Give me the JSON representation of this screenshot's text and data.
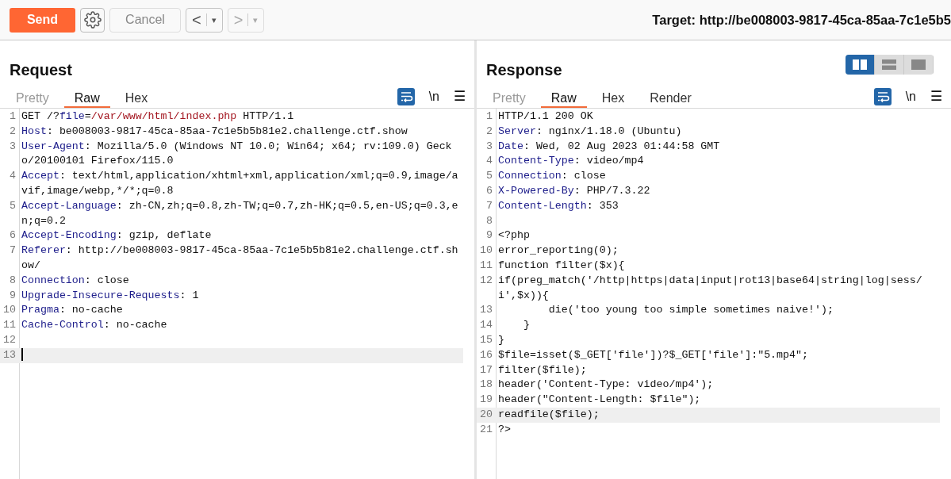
{
  "toolbar": {
    "send": "Send",
    "cancel": {
      "label": "Cancel",
      "disabled": true
    },
    "back": {
      "label": "<",
      "dropdown": "▾",
      "disabled": false
    },
    "forward": {
      "label": ">",
      "dropdown": "▾",
      "disabled": true
    },
    "target": "Target: http://be008003-9817-45ca-85aa-7c1e5b5"
  },
  "layout_toggle": [
    {
      "kind": "columns",
      "selected": true
    },
    {
      "kind": "rows",
      "selected": false
    },
    {
      "kind": "single",
      "selected": false
    }
  ],
  "panels": [
    {
      "title": "Request",
      "tabs": [
        {
          "label": "Pretty",
          "selected": false
        },
        {
          "label": "Raw",
          "selected": true
        },
        {
          "label": "Hex",
          "selected": false
        }
      ],
      "tools": {
        "wrap": true,
        "newline": "\\n",
        "menu": "☰"
      },
      "lines": [
        {
          "number": "1",
          "highlighted": false,
          "parts": [
            {
              "kind": "text",
              "text": "GET /?"
            },
            {
              "kind": "name",
              "text": "file"
            },
            {
              "kind": "text",
              "text": "="
            },
            {
              "kind": "param",
              "text": "/var/www/html/index.php"
            },
            {
              "kind": "text",
              "text": " HTTP/1.1"
            }
          ]
        },
        {
          "number": "2",
          "highlighted": false,
          "parts": [
            {
              "kind": "name",
              "text": "Host"
            },
            {
              "kind": "text",
              "text": ": be008003-9817-45ca-85aa-7c1e5b5b81e2.challenge.ctf.show"
            }
          ]
        },
        {
          "number": "3",
          "highlighted": false,
          "parts": [
            {
              "kind": "name",
              "text": "User-Agent"
            },
            {
              "kind": "text",
              "text": ": Mozilla/5.0 (Windows NT 10.0; Win64; x64; rv:109.0) Gecko/20100101 Firefox/115.0"
            }
          ]
        },
        {
          "number": "4",
          "highlighted": false,
          "parts": [
            {
              "kind": "name",
              "text": "Accept"
            },
            {
              "kind": "text",
              "text": ": text/html,application/xhtml+xml,application/xml;q=0.9,image/avif,image/webp,*/*;q=0.8"
            }
          ]
        },
        {
          "number": "5",
          "highlighted": false,
          "parts": [
            {
              "kind": "name",
              "text": "Accept-Language"
            },
            {
              "kind": "text",
              "text": ": zh-CN,zh;q=0.8,zh-TW;q=0.7,zh-HK;q=0.5,en-US;q=0.3,en;q=0.2"
            }
          ]
        },
        {
          "number": "6",
          "highlighted": false,
          "parts": [
            {
              "kind": "name",
              "text": "Accept-Encoding"
            },
            {
              "kind": "text",
              "text": ": gzip, deflate"
            }
          ]
        },
        {
          "number": "7",
          "highlighted": false,
          "parts": [
            {
              "kind": "name",
              "text": "Referer"
            },
            {
              "kind": "text",
              "text": ": http://be008003-9817-45ca-85aa-7c1e5b5b81e2.challenge.ctf.show/"
            }
          ]
        },
        {
          "number": "8",
          "highlighted": false,
          "parts": [
            {
              "kind": "name",
              "text": "Connection"
            },
            {
              "kind": "text",
              "text": ": close"
            }
          ]
        },
        {
          "number": "9",
          "highlighted": false,
          "parts": [
            {
              "kind": "name",
              "text": "Upgrade-Insecure-Requests"
            },
            {
              "kind": "text",
              "text": ": 1"
            }
          ]
        },
        {
          "number": "10",
          "highlighted": false,
          "parts": [
            {
              "kind": "name",
              "text": "Pragma"
            },
            {
              "kind": "text",
              "text": ": no-cache"
            }
          ]
        },
        {
          "number": "11",
          "highlighted": false,
          "parts": [
            {
              "kind": "name",
              "text": "Cache-Control"
            },
            {
              "kind": "text",
              "text": ": no-cache"
            }
          ]
        },
        {
          "number": "12",
          "highlighted": false
        },
        {
          "number": "13",
          "highlighted": true,
          "cursor": true
        }
      ]
    },
    {
      "title": "Response",
      "tabs": [
        {
          "label": "Pretty",
          "selected": false
        },
        {
          "label": "Raw",
          "selected": true
        },
        {
          "label": "Hex",
          "selected": false
        },
        {
          "label": "Render",
          "selected": false
        }
      ],
      "tools": {
        "wrap": true,
        "newline": "\\n",
        "menu": "☰"
      },
      "lines": [
        {
          "number": "1",
          "highlighted": false,
          "parts": [
            {
              "kind": "text",
              "text": "HTTP/1.1 200 OK"
            }
          ]
        },
        {
          "number": "2",
          "highlighted": false,
          "parts": [
            {
              "kind": "name",
              "text": "Server"
            },
            {
              "kind": "text",
              "text": ": nginx/1.18.0 (Ubuntu)"
            }
          ]
        },
        {
          "number": "3",
          "highlighted": false,
          "parts": [
            {
              "kind": "name",
              "text": "Date"
            },
            {
              "kind": "text",
              "text": ": Wed, 02 Aug 2023 01:44:58 GMT"
            }
          ]
        },
        {
          "number": "4",
          "highlighted": false,
          "parts": [
            {
              "kind": "name",
              "text": "Content-Type"
            },
            {
              "kind": "text",
              "text": ": video/mp4"
            }
          ]
        },
        {
          "number": "5",
          "highlighted": false,
          "parts": [
            {
              "kind": "name",
              "text": "Connection"
            },
            {
              "kind": "text",
              "text": ": close"
            }
          ]
        },
        {
          "number": "6",
          "highlighted": false,
          "parts": [
            {
              "kind": "name",
              "text": "X-Powered-By"
            },
            {
              "kind": "text",
              "text": ": PHP/7.3.22"
            }
          ]
        },
        {
          "number": "7",
          "highlighted": false,
          "parts": [
            {
              "kind": "name",
              "text": "Content-Length"
            },
            {
              "kind": "text",
              "text": ": 353"
            }
          ]
        },
        {
          "number": "8",
          "highlighted": false
        },
        {
          "number": "9",
          "highlighted": false,
          "parts": [
            {
              "kind": "text",
              "text": "<?php"
            }
          ]
        },
        {
          "number": "10",
          "highlighted": false,
          "parts": [
            {
              "kind": "text",
              "text": "error_reporting(0);"
            }
          ]
        },
        {
          "number": "11",
          "highlighted": false,
          "parts": [
            {
              "kind": "text",
              "text": "function filter($x){"
            }
          ]
        },
        {
          "number": "12",
          "highlighted": false,
          "parts": [
            {
              "kind": "text",
              "text": "if(preg_match('/http|https|data|input|rot13|base64|string|log|sess/i',$x)){"
            }
          ]
        },
        {
          "number": "13",
          "highlighted": false,
          "parts": [
            {
              "kind": "text",
              "text": "        die('too young too simple sometimes naive!');"
            }
          ]
        },
        {
          "number": "14",
          "highlighted": false,
          "parts": [
            {
              "kind": "text",
              "text": "    }"
            }
          ]
        },
        {
          "number": "15",
          "highlighted": false,
          "parts": [
            {
              "kind": "text",
              "text": "}"
            }
          ]
        },
        {
          "number": "16",
          "highlighted": false,
          "parts": [
            {
              "kind": "text",
              "text": "$file=isset($_GET['file'])?$_GET['file']:\"5.mp4\";"
            }
          ]
        },
        {
          "number": "17",
          "highlighted": false,
          "parts": [
            {
              "kind": "text",
              "text": "filter($file);"
            }
          ]
        },
        {
          "number": "18",
          "highlighted": false,
          "parts": [
            {
              "kind": "text",
              "text": "header('Content-Type: video/mp4');"
            }
          ]
        },
        {
          "number": "19",
          "highlighted": false,
          "parts": [
            {
              "kind": "text",
              "text": "header(\"Content-Length: $file\");"
            }
          ]
        },
        {
          "number": "20",
          "highlighted": true,
          "parts": [
            {
              "kind": "text",
              "text": "readfile($file);"
            }
          ]
        },
        {
          "number": "21",
          "highlighted": false,
          "parts": [
            {
              "kind": "text",
              "text": "?>"
            }
          ]
        }
      ]
    }
  ]
}
